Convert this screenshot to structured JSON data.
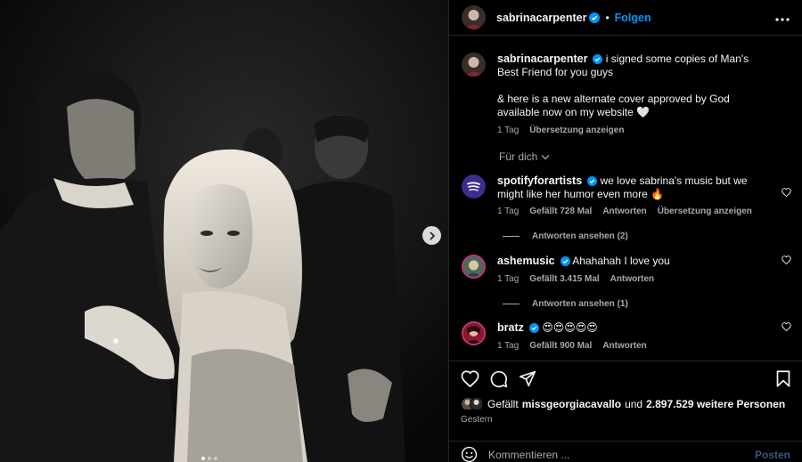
{
  "post": {
    "author": "sabrinacarpenter",
    "follow_label": "Folgen",
    "separator": "•"
  },
  "caption": {
    "username": "sabrinacarpenter",
    "line1": "i signed some copies of Man's Best Friend for you guys",
    "line2": "& here is a new alternate cover approved by God available now on my website 🤍",
    "time": "1 Tag",
    "translate": "Übersetzung anzeigen"
  },
  "for_you_label": "Für dich",
  "comments": [
    {
      "username": "spotifyforartists",
      "text": "we love sabrina's music but we might like her humor even more 🔥",
      "time": "1 Tag",
      "likes": "Gefällt 728 Mal",
      "reply": "Antworten",
      "translate": "Übersetzung anzeigen",
      "view_replies": "Antworten ansehen (2)"
    },
    {
      "username": "ashemusic",
      "text": "Ahahahah I love you",
      "time": "1 Tag",
      "likes": "Gefällt 3.415 Mal",
      "reply": "Antworten",
      "view_replies": "Antworten ansehen (1)"
    },
    {
      "username": "bratz",
      "text": "😍😍😍😍😍",
      "time": "1 Tag",
      "likes": "Gefällt 900 Mal",
      "reply": "Antworten"
    }
  ],
  "likes_line": {
    "prefix": "Gefällt",
    "user": "missgeorgiacavallo",
    "middle": "und",
    "count": "2.897.529 weitere Personen"
  },
  "date": "Gestern",
  "composer": {
    "placeholder": "Kommentieren ...",
    "post_label": "Posten"
  },
  "carousel": {
    "total": 3,
    "current": 1
  },
  "colors": {
    "accent": "#0095f6",
    "verified": "#0095f6",
    "muted": "#a8a8a8",
    "post_disabled": "#385a7c",
    "background": "#000000"
  },
  "icons": [
    "more-horizontal-icon",
    "verified-badge-icon",
    "heart-icon",
    "comment-icon",
    "share-icon",
    "bookmark-icon",
    "emoji-icon",
    "chevron-right-icon",
    "chevron-down-icon"
  ]
}
